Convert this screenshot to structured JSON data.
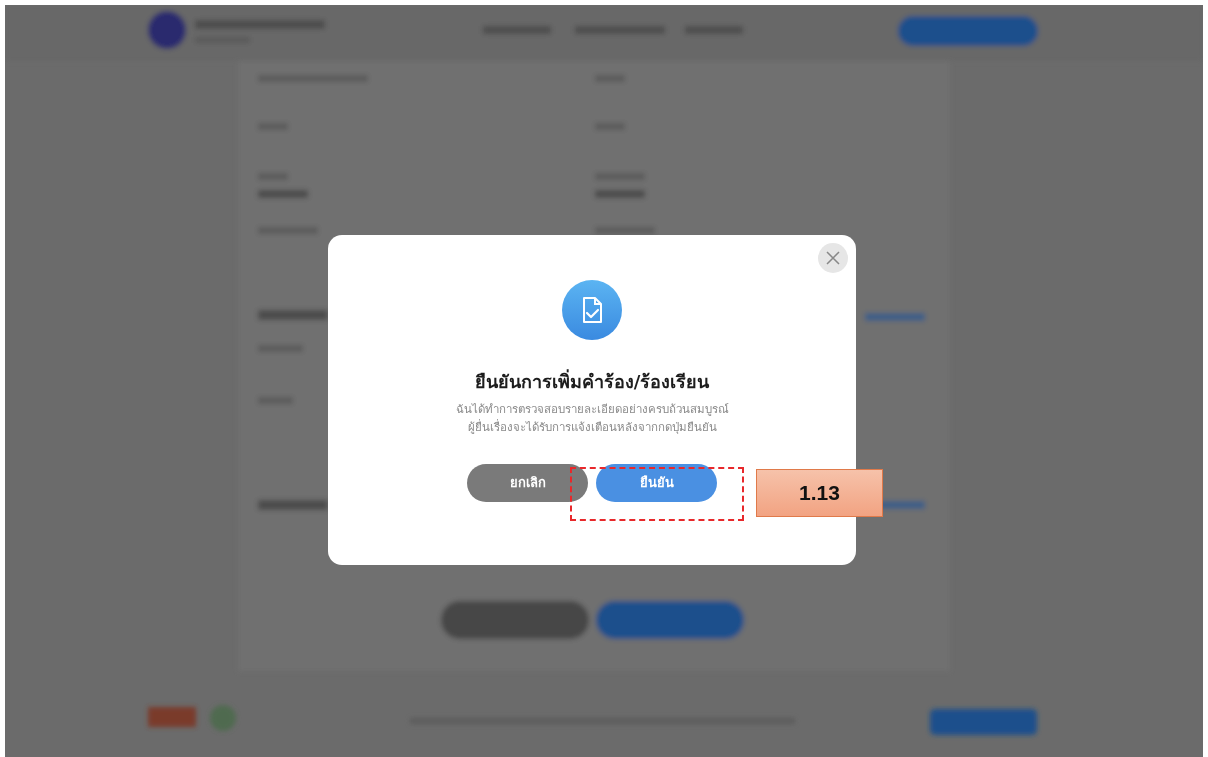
{
  "dialog": {
    "title": "ยืนยันการเพิ่มคำร้อง/ร้องเรียน",
    "message_lines": [
      "ฉันได้ทำการตรวจสอบรายละเอียดอย่างครบถ้วนสมบูรณ์",
      "ผู้ยื่นเรื่องจะได้รับการแจ้งเตือนหลังจากกดปุ่มยืนยัน"
    ],
    "buttons": [
      {
        "label": "ยกเลิก",
        "kind": "secondary"
      },
      {
        "label": "ยืนยัน",
        "kind": "primary"
      }
    ]
  },
  "annotation": {
    "label": "1.13"
  }
}
